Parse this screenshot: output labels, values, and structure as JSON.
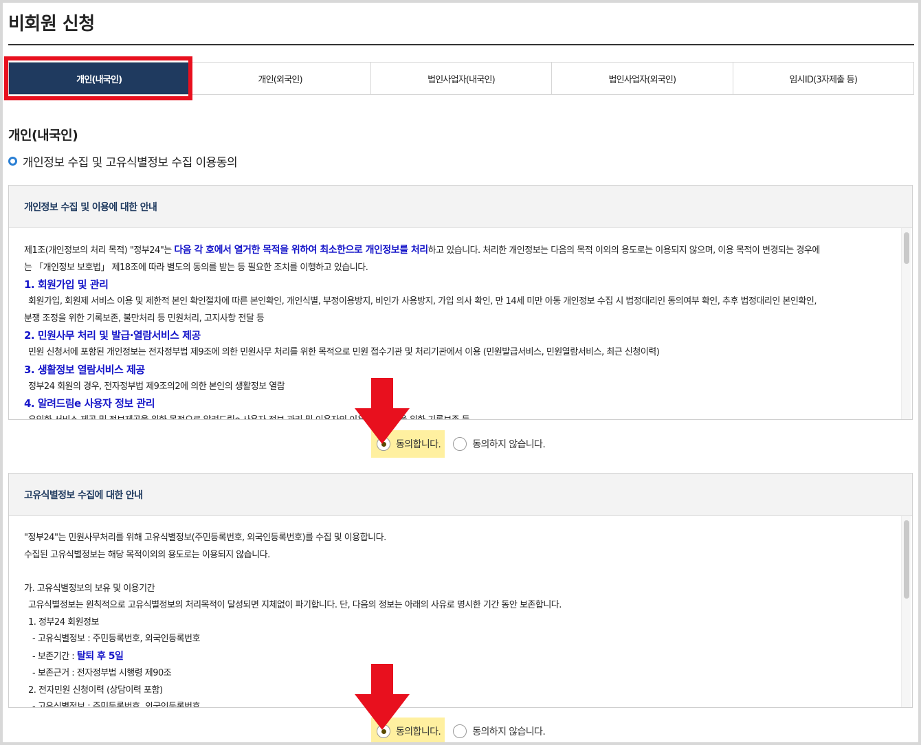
{
  "page": {
    "title": "비회원 신청",
    "accent_color": "#1f3a5f",
    "highlight_color": "#e8101e"
  },
  "tabs": [
    {
      "label": "개인(내국인)",
      "active": true
    },
    {
      "label": "개인(외국인)",
      "active": false
    },
    {
      "label": "법인사업자(내국인)",
      "active": false
    },
    {
      "label": "법인사업자(외국인)",
      "active": false
    },
    {
      "label": "임시ID(3자제출 등)",
      "active": false
    }
  ],
  "section": {
    "heading": "개인(내국인)",
    "sub_heading": "개인정보 수집 및 고유식별정보 수집 이용동의"
  },
  "notice1": {
    "header": "개인정보 수집 및 이용에 대한 안내",
    "intro_a": "제1조(개인정보의 처리 목적) \"정부24\"는 ",
    "intro_hl": "다음 각 호에서 열거한 목적을 위하여 최소한으로 개인정보를 처리",
    "intro_b": "하고 있습니다. 처리한 개인정보는 다음의 목적 이외의 용도로는 이용되지 않으며, 이용 목적이 변경되는 경우에",
    "intro_c": "는 「개인정보 보호법」 제18조에 따라 별도의 동의를 받는 등 필요한 조치를 이행하고 있습니다.",
    "item1_title": "1. 회원가입 및 관리",
    "item1_text_a": "회원가입, 회원제 서비스 이용 및 제한적 본인 확인절차에 따른 본인확인, 개인식별, 부정이용방지, 비인가 사용방지, 가입 의사 확인, 만 14세 미만 아동 개인정보 수집 시 법정대리인 동의여부 확인, 추후 법정대리인 본인확인,",
    "item1_text_b": "분쟁 조정을 위한 기록보존, 불만처리 등 민원처리, 고지사항 전달 등",
    "item2_title": "2. 민원사무 처리 및 발급·열람서비스 제공",
    "item2_text": "민원 신청서에 포함된 개인정보는 전자정부법 제9조에 의한 민원사무 처리를 위한 목적으로 민원 접수기관 및 처리기관에서 이용 (민원발급서비스, 민원열람서비스, 최근 신청이력)",
    "item3_title": "3. 생활정보 열람서비스 제공",
    "item3_text": "정부24 회원의 경우, 전자정부법 제9조의2에 의한 본인의 생활정보 열람",
    "item4_title": "4. 알려드림e 사용자 정보 관리",
    "item4_text": "유익한 서비스 제공 및 정보제공을 위한 목적으로 알려드림e 사용자 정보 관리 및 이용자의 이용현황 파악을 위한 기록보존 등"
  },
  "notice2": {
    "header": "고유식별정보 수집에 대한 안내",
    "line1": "\"정부24\"는 민원사무처리를 위해 고유식별정보(주민등록번호, 외국인등록번호)를 수집 및 이용합니다.",
    "line2": "수집된 고유식별정보는 해당 목적이외의 용도로는 이용되지 않습니다.",
    "line3": "가. 고유식별정보의 보유 및 이용기간",
    "line4": "고유식별정보는 원칙적으로 고유식별정보의 처리목적이 달성되면 지체없이 파기합니다. 단, 다음의 정보는 아래의 사유로 명시한 기간 동안 보존합니다.",
    "line5": "1. 정부24 회원정보",
    "line6": "- 고유식별정보 : 주민등록번호, 외국인등록번호",
    "line7_a": "- 보존기간 : ",
    "line7_hl": "탈퇴 후 5일",
    "line8": "- 보존근거 : 전자정부법 시행령 제90조",
    "line9": "2. 전자민원 신청이력 (상담이력 포함)",
    "line10": "- 고유식별정보 : 주민등록번호, 외국인등록번호"
  },
  "consent1": {
    "agree": "동의합니다.",
    "disagree": "동의하지 않습니다.",
    "selected": "agree"
  },
  "consent2": {
    "agree": "동의합니다.",
    "disagree": "동의하지 않습니다.",
    "selected": "agree"
  }
}
